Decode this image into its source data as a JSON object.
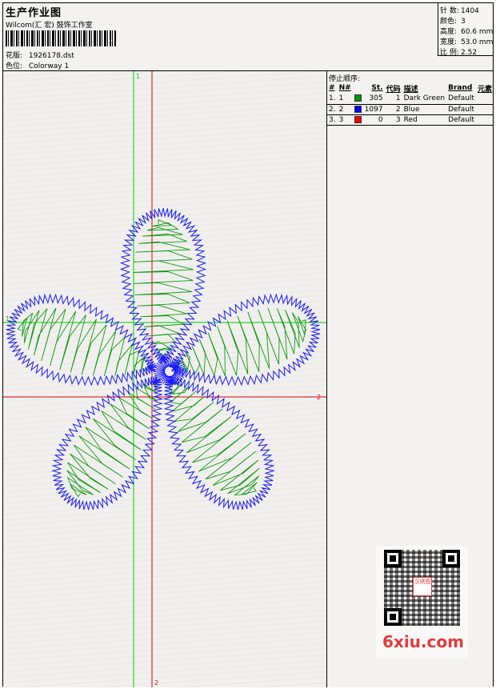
{
  "header": {
    "title": "生产作业图",
    "studio": "Wilcom(汇 宏) 鼓饰工作室",
    "design_label": "花版:",
    "design_file": "1926178.dst",
    "colorway_label": "色位:",
    "colorway": "Colorway 1"
  },
  "stats": [
    {
      "label": "针 数:",
      "value": "1404"
    },
    {
      "label": "颜色:",
      "value": "3"
    },
    {
      "label": "高度:",
      "value": "60.6 mm"
    },
    {
      "label": "宽度:",
      "value": "53.0 mm"
    },
    {
      "label": "比 例:",
      "value": "2.52"
    }
  ],
  "guides": {
    "green_marker": "1",
    "red_marker": "2",
    "green_color": "#00cc00",
    "red_color": "#dd0000"
  },
  "design_colors": {
    "outline": "#1a1aff",
    "fill": "#0d9a0d"
  },
  "stop_sequence": {
    "title": "停止顺序:",
    "headers": [
      "#",
      "N#",
      "St.",
      "代码",
      "描述",
      "Brand",
      "元素"
    ],
    "rows": [
      {
        "idx": "1.",
        "n": "1",
        "color": "#009900",
        "stitches": "305",
        "code": "1",
        "desc": "Dark Green",
        "brand": "Default",
        "elements": ""
      },
      {
        "idx": "2.",
        "n": "2",
        "color": "#0000ff",
        "stitches": "1097",
        "code": "2",
        "desc": "Blue",
        "brand": "Default",
        "elements": ""
      },
      {
        "idx": "3.",
        "n": "3",
        "color": "#ff0000",
        "stitches": "0",
        "code": "3",
        "desc": "Red",
        "brand": "Default",
        "elements": ""
      }
    ]
  },
  "watermark": {
    "qr_logo_text": "汉绣图",
    "site": "6xiu.com"
  }
}
